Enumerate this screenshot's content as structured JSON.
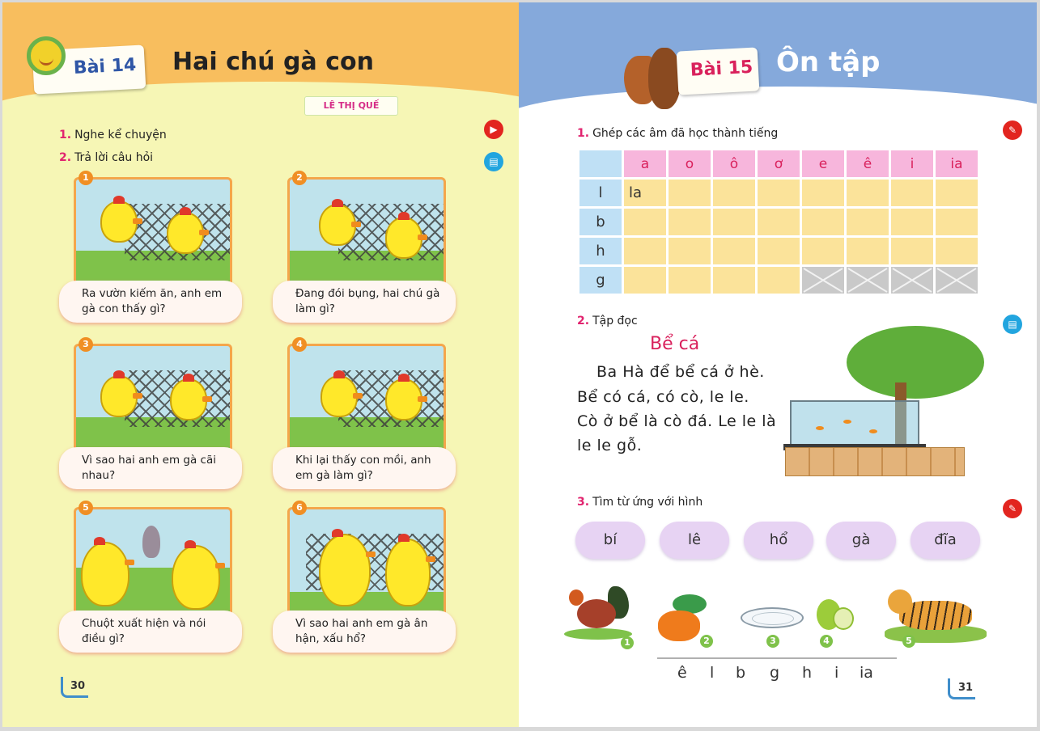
{
  "left_page": {
    "lesson_label": "Bài 14",
    "lesson_title": "Hai chú gà con",
    "author": "LÊ THỊ QUẾ",
    "tasks": [
      {
        "num": "1.",
        "text": "Nghe kể chuyện"
      },
      {
        "num": "2.",
        "text": "Trả lời câu hỏi"
      }
    ],
    "panels": [
      {
        "num": "1",
        "caption": "Ra vườn kiếm ăn, anh em gà con thấy gì?"
      },
      {
        "num": "2",
        "caption": "Đang đói bụng, hai chú gà làm gì?"
      },
      {
        "num": "3",
        "caption": "Vì sao hai anh em gà cãi nhau?"
      },
      {
        "num": "4",
        "caption": "Khi lại thấy con mồi, anh em gà làm gì?"
      },
      {
        "num": "5",
        "caption": "Chuột xuất hiện và nói điều gì?"
      },
      {
        "num": "6",
        "caption": "Vì sao hai anh em gà ân hận, xấu hổ?"
      }
    ],
    "page_number": "30",
    "colors": {
      "header": "#f8be5e",
      "background": "#f6f6b5",
      "accent": "#e1246f"
    }
  },
  "right_page": {
    "lesson_label": "Bài 15",
    "lesson_title": "Ôn tập",
    "task1": {
      "num": "1.",
      "text": "Ghép các âm đã học thành tiếng"
    },
    "grid": {
      "columns": [
        "a",
        "o",
        "ô",
        "ơ",
        "e",
        "ê",
        "i",
        "ia"
      ],
      "rows": [
        {
          "head": "l",
          "cells": [
            "la",
            "",
            "",
            "",
            "",
            "",
            "",
            ""
          ]
        },
        {
          "head": "b",
          "cells": [
            "",
            "",
            "",
            "",
            "",
            "",
            "",
            ""
          ]
        },
        {
          "head": "h",
          "cells": [
            "",
            "",
            "",
            "",
            "",
            "",
            "",
            ""
          ]
        },
        {
          "head": "g",
          "cells": [
            "",
            "",
            "",
            "",
            "x",
            "x",
            "x",
            "x"
          ]
        }
      ]
    },
    "task2": {
      "num": "2.",
      "text": "Tập đọc"
    },
    "reading": {
      "title": "Bể cá",
      "lines": [
        "Ba Hà để bể cá ở hè.",
        "Bể có cá, có cò, le le.",
        "Cò ở bể là cò đá. Le le là",
        "le le gỗ."
      ]
    },
    "task3": {
      "num": "3.",
      "text": "Tìm từ ứng với hình"
    },
    "words": [
      "bí",
      "lê",
      "hổ",
      "gà",
      "đĩa"
    ],
    "pictures": [
      {
        "num": "1",
        "icon": "rooster-icon"
      },
      {
        "num": "2",
        "icon": "pumpkin-icon"
      },
      {
        "num": "3",
        "icon": "plate-icon"
      },
      {
        "num": "4",
        "icon": "pear-icon"
      },
      {
        "num": "5",
        "icon": "tiger-icon"
      }
    ],
    "letters": [
      "ê",
      "l",
      "b",
      "g",
      "h",
      "i",
      "ia"
    ],
    "page_number": "31",
    "colors": {
      "header": "#85a9db",
      "grid_header": "#f7b6dc",
      "grid_row": "#bfe0f5",
      "grid_cell": "#fbe39a",
      "word_cloud": "#e7d3f3"
    }
  }
}
